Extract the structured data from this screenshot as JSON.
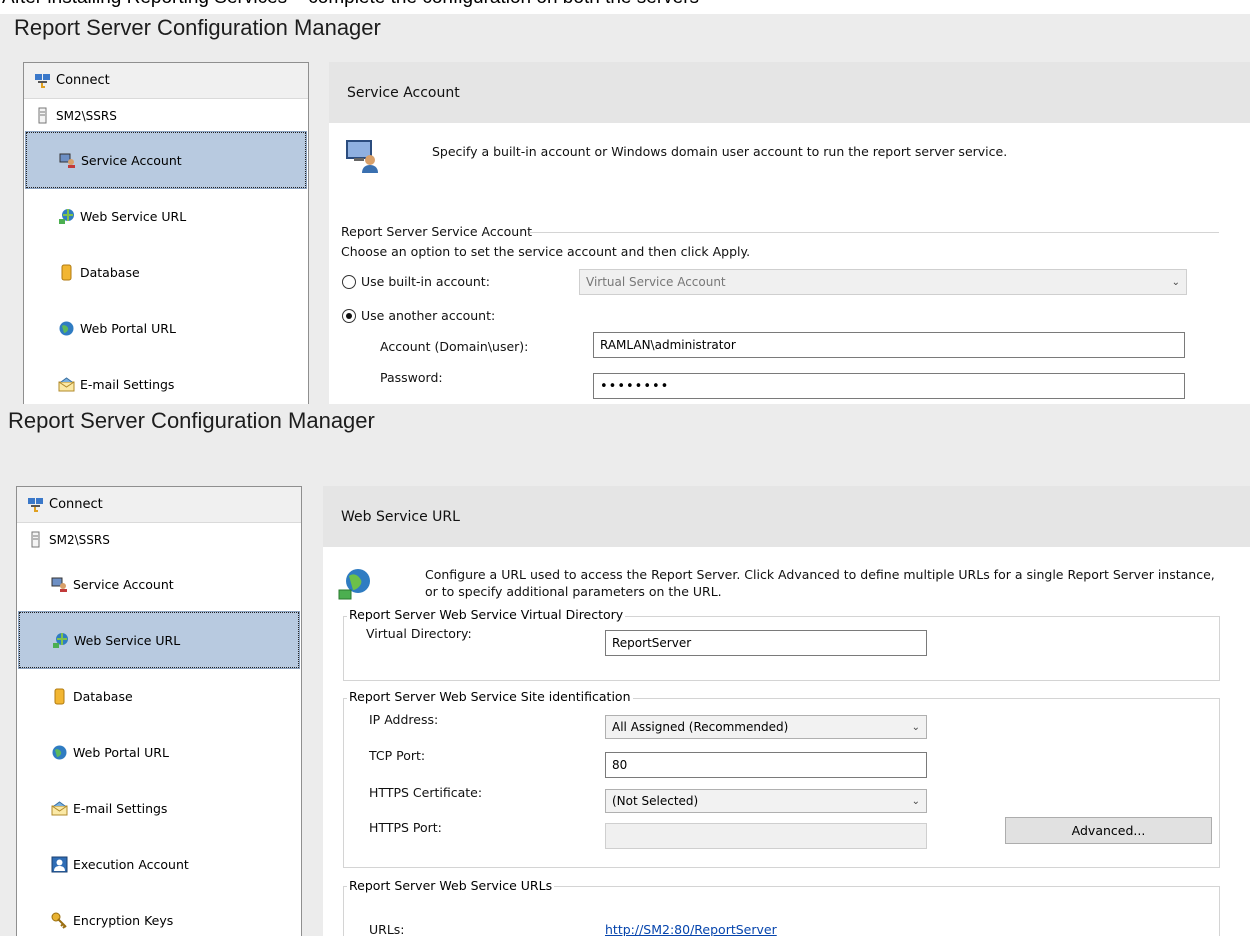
{
  "caption": "After installing Reporting Services – complete the configuration on both the servers",
  "app_title": "Report Server Configuration Manager",
  "shot1": {
    "nav": {
      "connect": "Connect",
      "server": "SM2\\SSRS",
      "items": [
        "Service Account",
        "Web Service URL",
        "Database",
        "Web Portal URL",
        "E-mail Settings"
      ]
    },
    "section_title": "Service Account",
    "description": "Specify a built-in account or Windows domain user account to run the report server service.",
    "group_title": "Report Server Service Account",
    "instruction": "Choose an option to set the service account and then click Apply.",
    "builtin_label": "Use built-in account:",
    "builtin_value": "Virtual Service Account",
    "another_label": "Use another account:",
    "account_label": "Account (Domain\\user):",
    "account_value": "RAMLAN\\administrator",
    "password_label": "Password:",
    "password_value": "••••••••"
  },
  "shot2": {
    "nav": {
      "connect": "Connect",
      "server": "SM2\\SSRS",
      "items": [
        "Service Account",
        "Web Service URL",
        "Database",
        "Web Portal URL",
        "E-mail Settings",
        "Execution Account",
        "Encryption Keys"
      ]
    },
    "section_title": "Web Service URL",
    "description": "Configure a URL used to access the Report Server.  Click Advanced to define multiple URLs for a single Report Server instance, or to specify additional parameters on the URL.",
    "vdir_group": "Report Server Web Service Virtual Directory",
    "vdir_label": "Virtual Directory:",
    "vdir_value": "ReportServer",
    "site_group": "Report Server Web Service Site identification",
    "ip_label": "IP Address:",
    "ip_value": "All Assigned (Recommended)",
    "tcp_label": "TCP Port:",
    "tcp_value": "80",
    "cert_label": "HTTPS Certificate:",
    "cert_value": "(Not Selected)",
    "https_port_label": "HTTPS Port:",
    "advanced_label": "Advanced...",
    "urls_group": "Report Server Web Service URLs",
    "urls_label": "URLs:",
    "url_value": "http://SM2:80/ReportServer"
  }
}
